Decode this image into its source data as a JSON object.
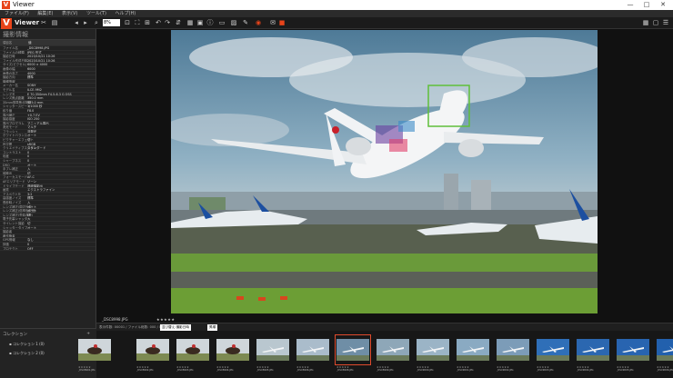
{
  "window": {
    "title": "Viewer",
    "logo_letter": "V",
    "min": "—",
    "max": "□",
    "close": "✕"
  },
  "menu": [
    "ファイル(F)",
    "編集(E)",
    "表示(V)",
    "ツール(T)",
    "ヘルプ(H)"
  ],
  "toolbar": {
    "app_name": "Viewer",
    "zoom_value": "8%"
  },
  "left_panel": {
    "title": "撮影情報",
    "header_key": "項目名",
    "header_value": "値",
    "properties": [
      [
        "ファイル名",
        "_DSC8998.JPG"
      ],
      [
        "ファイルの種類",
        "JPEG 形式"
      ],
      [
        "撮影日時",
        "2023/10/21 10:26"
      ],
      [
        "ファイル作成日時",
        "2023/10/21 10:26"
      ],
      [
        "サイズ(ピクセル)",
        "6000 × 4000"
      ],
      [
        "画像の幅",
        "6000"
      ],
      [
        "画像の高さ",
        "4000"
      ],
      [
        "撮影方向",
        "標準"
      ],
      [
        "機種情報",
        ""
      ],
      [
        "メーカー名",
        "SONY"
      ],
      [
        "モデル名",
        "ILCE-9M2"
      ],
      [
        "レンズ名",
        "E 70-350mm F4.5-6.3 G OSS"
      ],
      [
        "レンズ焦点距離",
        "350.0 mm"
      ],
      [
        "35mm換算焦点距離",
        "525.0 mm"
      ],
      [
        "シャッタースピード",
        "1/1000 秒"
      ],
      [
        "絞り値",
        "F8.0"
      ],
      [
        "露出補正",
        "+0.7 EV"
      ],
      [
        "撮影感度",
        "ISO 250"
      ],
      [
        "露出プログラム",
        "マニュアル露出"
      ],
      [
        "測光モード",
        "マルチ"
      ],
      [
        "フラッシュ",
        "非発光"
      ],
      [
        "ホワイトバランス",
        "オート"
      ],
      [
        "ピクチャーエフェクト",
        "切"
      ],
      [
        "色空間",
        "sRGB"
      ],
      [
        "クリエイティブスタイル",
        "スタンダード"
      ],
      [
        "コントラスト",
        "0"
      ],
      [
        "彩度",
        "0"
      ],
      [
        "シャープネス",
        "0"
      ],
      [
        "DRO",
        "オート"
      ],
      [
        "手ブレ補正",
        "入"
      ],
      [
        "顔検出",
        "切"
      ],
      [
        "フォーカスモード",
        "AF-C"
      ],
      [
        "AFエリアモード",
        "ゾーン"
      ],
      [
        "ドライブモード",
        "連続撮影Hi"
      ],
      [
        "画質",
        "エクストラファイン"
      ],
      [
        "アスペクト比",
        "3:2"
      ],
      [
        "高感度ノイズ",
        "標準"
      ],
      [
        "長秒時ノイズ",
        "入"
      ],
      [
        "レンズ補正(周辺光量)",
        "オート"
      ],
      [
        "レンズ補正(倍率色収差)",
        "オート"
      ],
      [
        "レンズ補正(歪曲収差)",
        "切"
      ],
      [
        "電子先幕シャッター",
        "入"
      ],
      [
        "サイレント撮影",
        "切"
      ],
      [
        "シャッタータイプ",
        "オート"
      ],
      [
        "撮影者",
        ""
      ],
      [
        "著作権者",
        ""
      ],
      [
        "GPS情報",
        "なし"
      ],
      [
        "評価",
        "0"
      ],
      [
        "プロテクト",
        "OFF"
      ]
    ]
  },
  "collections": {
    "title": "コレクション",
    "add_icon": "+",
    "items": [
      "コレクション 1 (0)",
      "コレクション 2 (0)"
    ]
  },
  "viewer": {
    "filename": "_DSC8998.JPG",
    "stars": "★★★★★"
  },
  "filmbar": {
    "count_text": "表示件数: 00001 / ファイル総数: 000 / 000",
    "sort_label": "並び替え:撮影日時",
    "sort_value": "昇順"
  },
  "thumbnails": [
    {
      "name": "_DSC8991.JPG",
      "stars": "★★★★★"
    },
    {
      "name": "_DSC8992.JPG",
      "stars": "★★★★★"
    },
    {
      "name": "_DSC8993.JPG",
      "stars": "★★★★★"
    },
    {
      "name": "_DSC8994.JPG",
      "stars": "★★★★★"
    },
    {
      "name": "_DSC8995.JPG",
      "stars": "★★★★★"
    },
    {
      "name": "_DSC8996.JPG",
      "stars": "★★★★★"
    },
    {
      "name": "_DSC8998.JPG",
      "stars": "★★★★★"
    },
    {
      "name": "_DSC8999.JPG",
      "stars": "★★★★★"
    },
    {
      "name": "_DSC9000.JPG",
      "stars": "★★★★★"
    },
    {
      "name": "_DSC9001.JPG",
      "stars": "★★★★★"
    },
    {
      "name": "_DSC9002.JPG",
      "stars": "★★★★★"
    },
    {
      "name": "_DSC9003.JPG",
      "stars": "★★★★★"
    },
    {
      "name": "_DSC9004.JPG",
      "stars": "★★★★★"
    },
    {
      "name": "_DSC9005.JPG",
      "stars": "★★★★★"
    },
    {
      "name": "_DSC9006.JPG",
      "stars": "★★★★★"
    }
  ],
  "colors": {
    "accent": "#e8441a",
    "selection": "#e04b2d",
    "focus_box": "#5fbf3a"
  }
}
